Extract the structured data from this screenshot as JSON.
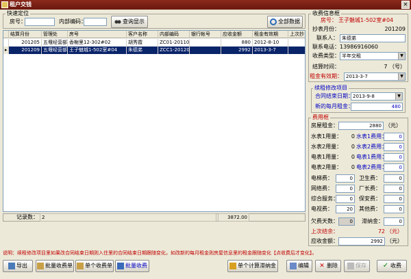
{
  "window": {
    "title": "租户交钱"
  },
  "quick": {
    "group_label": "快速定位",
    "room_label": "房号：",
    "room_value": "",
    "code_label": "内部编码：",
    "code_value": "",
    "query_button": "查询显示",
    "all_button": "全部数据"
  },
  "table": {
    "columns": [
      "结算月份",
      "管理处",
      "房号",
      "客户名称",
      "内部编码",
      "银行帐号",
      "应收金额",
      "租金有效期",
      "上次抄"
    ],
    "rows": [
      {
        "month": "201205",
        "office": "五堰经营部",
        "room": "香榭里12-302#02",
        "name": "胡秀霞",
        "code": "ZC01-201102",
        "bank": "",
        "amount": "880",
        "valid": "2012-8-10",
        "last": ""
      },
      {
        "month": "201209",
        "office": "五堰经营部",
        "room": "王子魅城1-502室#04",
        "name": "朱德弟",
        "code": "ZCC1-201203",
        "bank": "",
        "amount": "2992",
        "valid": "2013-3-7",
        "last": ""
      }
    ],
    "record_label": "记录数：",
    "record_count": "2",
    "total": "3872.00"
  },
  "info": {
    "group_label": "收费信息框",
    "room_label": "房号：",
    "room_value": "王子魅城1-502室#04",
    "month_label": "抄表月份：",
    "month_value": "201209",
    "contact_label": "联系人：",
    "contact_value": "朱德弟",
    "phone_label": "联系电话：",
    "phone_value": "13986916060",
    "type_label": "收费类型：",
    "type_value": "半年交租",
    "settle_label": "结算时间：",
    "settle_value": "7 （号）",
    "rent_valid_label": "租金有效期：",
    "rent_valid_value": "2013-3-7"
  },
  "modify": {
    "group_label": "续租修改项目",
    "contract_label": "合同结束日期：",
    "contract_value": "2013-9-8",
    "monthly_label": "新的每月租金：",
    "monthly_value": "480"
  },
  "fees": {
    "group_label": "费用框",
    "rent_label": "房屋租金：",
    "rent_value": "2880",
    "rent_unit": "（元）",
    "w1_label": "水表1用量：",
    "w1_value": "0",
    "w1f_label": "水表1费用：",
    "w1f_value": "0",
    "w2_label": "水表2用量：",
    "w2_value": "0",
    "w2f_label": "水表2费用：",
    "w2f_value": "0",
    "e1_label": "电表1用量：",
    "e1_value": "0",
    "e1f_label": "电表1费用：",
    "e1f_value": "0",
    "e2_label": "电表2用量：",
    "e2_value": "0",
    "e2f_label": "电表2费用：",
    "e2f_value": "0",
    "elev_label": "电梯费：",
    "elev_value": "0",
    "clean_label": "卫生费：",
    "clean_value": "0",
    "net_label": "网络费：",
    "net_value": "0",
    "plant_label": "厂长费：",
    "plant_value": "0",
    "svc_label": "综合服务：",
    "svc_value": "0",
    "guard_label": "保安费：",
    "guard_value": "0",
    "tv_label": "电视费：",
    "tv_value": "20",
    "other_label": "其他费：",
    "other_value": "0",
    "owe_label": "欠费天数：",
    "owe_value": "0",
    "late_label": "滞纳金：",
    "late_value": "0",
    "last_label": "上次结余：",
    "last_value": "72",
    "last_unit": "（元）",
    "due_label": "应收金额：",
    "due_value": "2992",
    "due_unit": "（元）"
  },
  "note": "说明：续租修改项目里如果改合同结束日期则入住里的合同结束日期跟随变化，如改新的每月租金则房屋信息里的租金跟随变化【点收费后才变化】。",
  "buttons": {
    "export": "导出",
    "batch_receipt": "批量收费单",
    "single_receipt": "单个收费单",
    "batch_charge": "批量收费",
    "calc_late": "单个计算滞纳金",
    "edit": "编辑",
    "delete": "删除",
    "save": "保存",
    "charge": "收费"
  }
}
